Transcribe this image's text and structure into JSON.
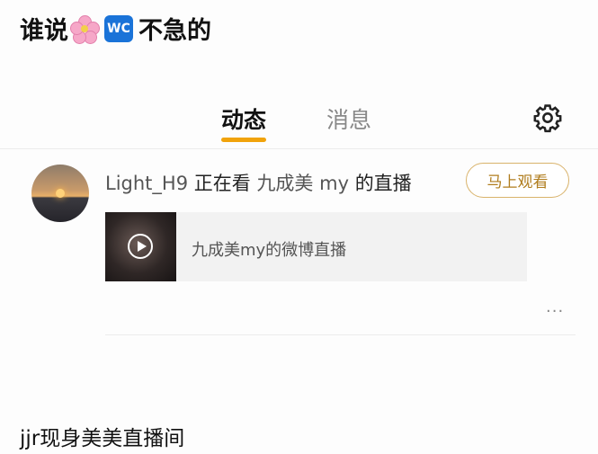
{
  "caption_top": {
    "text_before": "谁说",
    "badge": "WC",
    "text_after": "不急的"
  },
  "tabs": [
    {
      "label": "动态",
      "active": true
    },
    {
      "label": "消息",
      "active": false
    }
  ],
  "feed_item": {
    "user": "Light_H9",
    "action": "正在看",
    "target": "九成美 my",
    "suffix": "的直播",
    "watch_button": "马上观看",
    "card_title": "九成美my的微博直播",
    "more_label": "···"
  },
  "caption_bottom": "jjr现身美美直播间",
  "colors": {
    "accent": "#f1a30b",
    "button_border": "#d9b36b",
    "badge_blue": "#1a73d8"
  },
  "icons": [
    "flower-emoji-icon",
    "wc-badge-icon",
    "settings-gear-icon",
    "play-icon",
    "more-icon"
  ]
}
